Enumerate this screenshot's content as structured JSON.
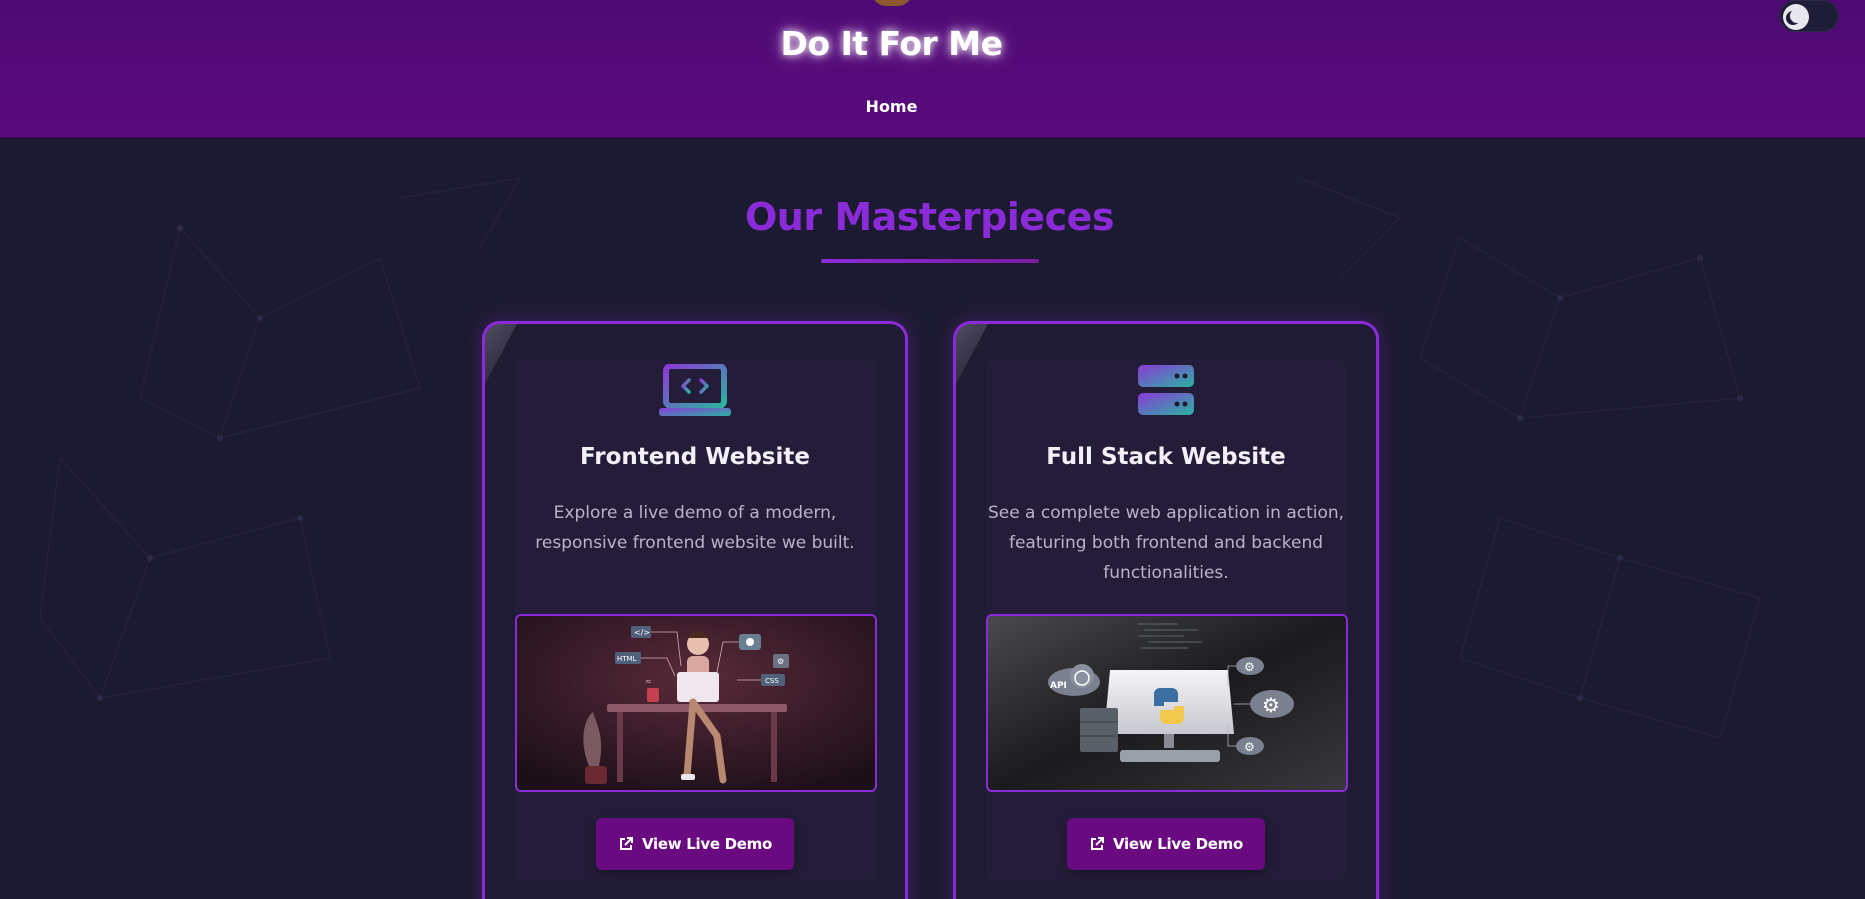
{
  "header": {
    "title": "Do It For Me",
    "nav": [
      {
        "label": "Home"
      }
    ]
  },
  "section": {
    "title": "Our Masterpieces"
  },
  "cards": [
    {
      "icon": "laptop-code-icon",
      "heading": "Frontend Website",
      "description": "Explore a live demo of a modern, responsive frontend website we built.",
      "button_label": "View Live Demo"
    },
    {
      "icon": "server-icon",
      "heading": "Full Stack Website",
      "description": "See a complete web application in action, featuring both frontend and backend functionalities.",
      "button_label": "View Live Demo"
    }
  ],
  "illustration_labels": {
    "frontend": [
      "</>",
      "HTML",
      "CSS"
    ],
    "fullstack": [
      "API"
    ]
  },
  "colors": {
    "header_bg": "#4d0a73",
    "page_bg": "#1c1a30",
    "accent_purple": "#8b2ad8",
    "button_bg": "#6a0a80",
    "icon_gradient_start": "#8b3ad8",
    "icon_gradient_end": "#2ab3a0"
  }
}
